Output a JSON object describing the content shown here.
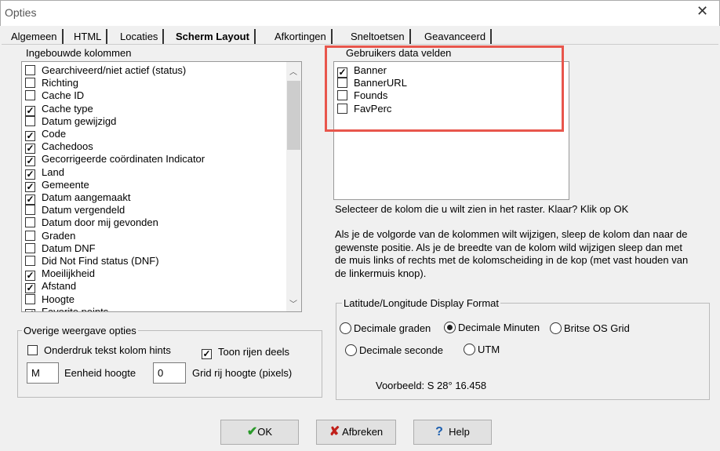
{
  "window": {
    "title": "Opties",
    "close": "✕"
  },
  "tabs": [
    {
      "label": "Algemeen"
    },
    {
      "label": "HTML"
    },
    {
      "label": "Locaties"
    },
    {
      "label": "Scherm Layout",
      "active": true
    },
    {
      "label": "Afkortingen"
    },
    {
      "label": "Sneltoetsen"
    },
    {
      "label": "Geavanceerd"
    }
  ],
  "builtin": {
    "label": "Ingebouwde kolommen",
    "items": [
      {
        "label": "Gearchiveerd/niet actief (status)",
        "checked": false
      },
      {
        "label": "Richting",
        "checked": false
      },
      {
        "label": "Cache ID",
        "checked": false
      },
      {
        "label": "Cache type",
        "checked": true
      },
      {
        "label": "Datum gewijzigd",
        "checked": false
      },
      {
        "label": "Code",
        "checked": true
      },
      {
        "label": "Cachedoos",
        "checked": true
      },
      {
        "label": "Gecorrigeerde coördinaten Indicator",
        "checked": true
      },
      {
        "label": "Land",
        "checked": true
      },
      {
        "label": "Gemeente",
        "checked": true
      },
      {
        "label": "Datum aangemaakt",
        "checked": true
      },
      {
        "label": "Datum vergendeld",
        "checked": false
      },
      {
        "label": "Datum door mij gevonden",
        "checked": false
      },
      {
        "label": "Graden",
        "checked": false
      },
      {
        "label": "Datum DNF",
        "checked": false
      },
      {
        "label": "Did Not Find status (DNF)",
        "checked": false
      },
      {
        "label": "Moeilijkheid",
        "checked": true
      },
      {
        "label": "Afstand",
        "checked": true
      },
      {
        "label": "Hoogte",
        "checked": false
      },
      {
        "label": "Favorite points",
        "checked": true
      }
    ]
  },
  "user_fields": {
    "label": "Gebruikers data velden",
    "highlight_color": "#e8564c",
    "items": [
      {
        "label": "Banner",
        "checked": true
      },
      {
        "label": "BannerURL",
        "checked": false
      },
      {
        "label": "Founds",
        "checked": false
      },
      {
        "label": "FavPerc",
        "checked": false
      }
    ]
  },
  "help1": "Selecteer de kolom die u wilt zien in het raster. Klaar? Klik op OK",
  "help2": "Als je de volgorde van de kolommen wilt wijzigen, sleep de kolom dan naar de gewenste positie. Als je de breedte van de kolom wild wijzigen sleep dan met de muis links of rechts met de kolomscheiding in de kop (met vast houden van de linkermuis knop).",
  "other": {
    "label": "Overige weergave opties",
    "suppress_hints": {
      "label": "Onderdruk tekst kolom hints",
      "checked": false
    },
    "show_rows": {
      "label": "Toon rijen deels",
      "checked": true
    },
    "unit_value": "M",
    "unit_label": "Eenheid hoogte",
    "grid_value": "0",
    "grid_label": "Grid rij hoogte (pixels)"
  },
  "latlon": {
    "label": "Latitude/Longitude Display Format",
    "options": [
      {
        "label": "Decimale graden",
        "selected": false
      },
      {
        "label": "Decimale Minuten",
        "selected": true
      },
      {
        "label": "Britse OS Grid",
        "selected": false
      },
      {
        "label": "Decimale seconde",
        "selected": false
      },
      {
        "label": "UTM",
        "selected": false
      }
    ],
    "example": "Voorbeeld: S 28° 16.458"
  },
  "buttons": {
    "ok": "OK",
    "cancel": "Afbreken",
    "help": "Help"
  }
}
